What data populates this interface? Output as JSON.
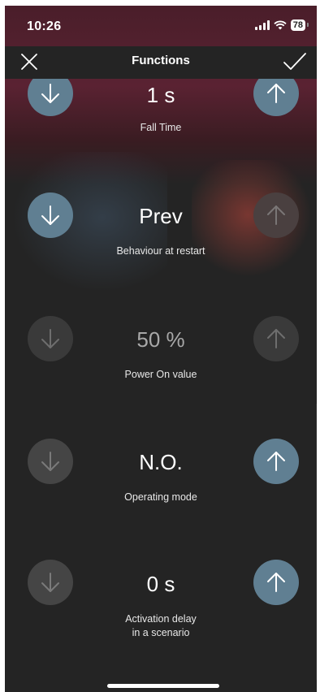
{
  "status_bar": {
    "time": "10:26",
    "battery": "78"
  },
  "header": {
    "title": "Functions",
    "close_icon": "close-icon",
    "confirm_icon": "checkmark-icon"
  },
  "settings": [
    {
      "value": "1 s",
      "label": "Fall Time",
      "down_enabled": true,
      "up_enabled": true
    },
    {
      "value": "Prev",
      "label": "Behaviour at restart",
      "down_enabled": true,
      "up_enabled": false
    },
    {
      "value": "50 %",
      "label": "Power On value",
      "down_enabled": false,
      "up_enabled": false
    },
    {
      "value": "N.O.",
      "label": "Operating mode",
      "down_enabled": false,
      "up_enabled": true
    },
    {
      "value": "0 s",
      "label_line1": "Activation delay",
      "label_line2": "in a scenario",
      "down_enabled": false,
      "up_enabled": true
    }
  ],
  "colors": {
    "background": "#242424",
    "button_active": "#607f92",
    "button_inactive": "#3a3a3a",
    "glow_red": "#5a2232"
  }
}
